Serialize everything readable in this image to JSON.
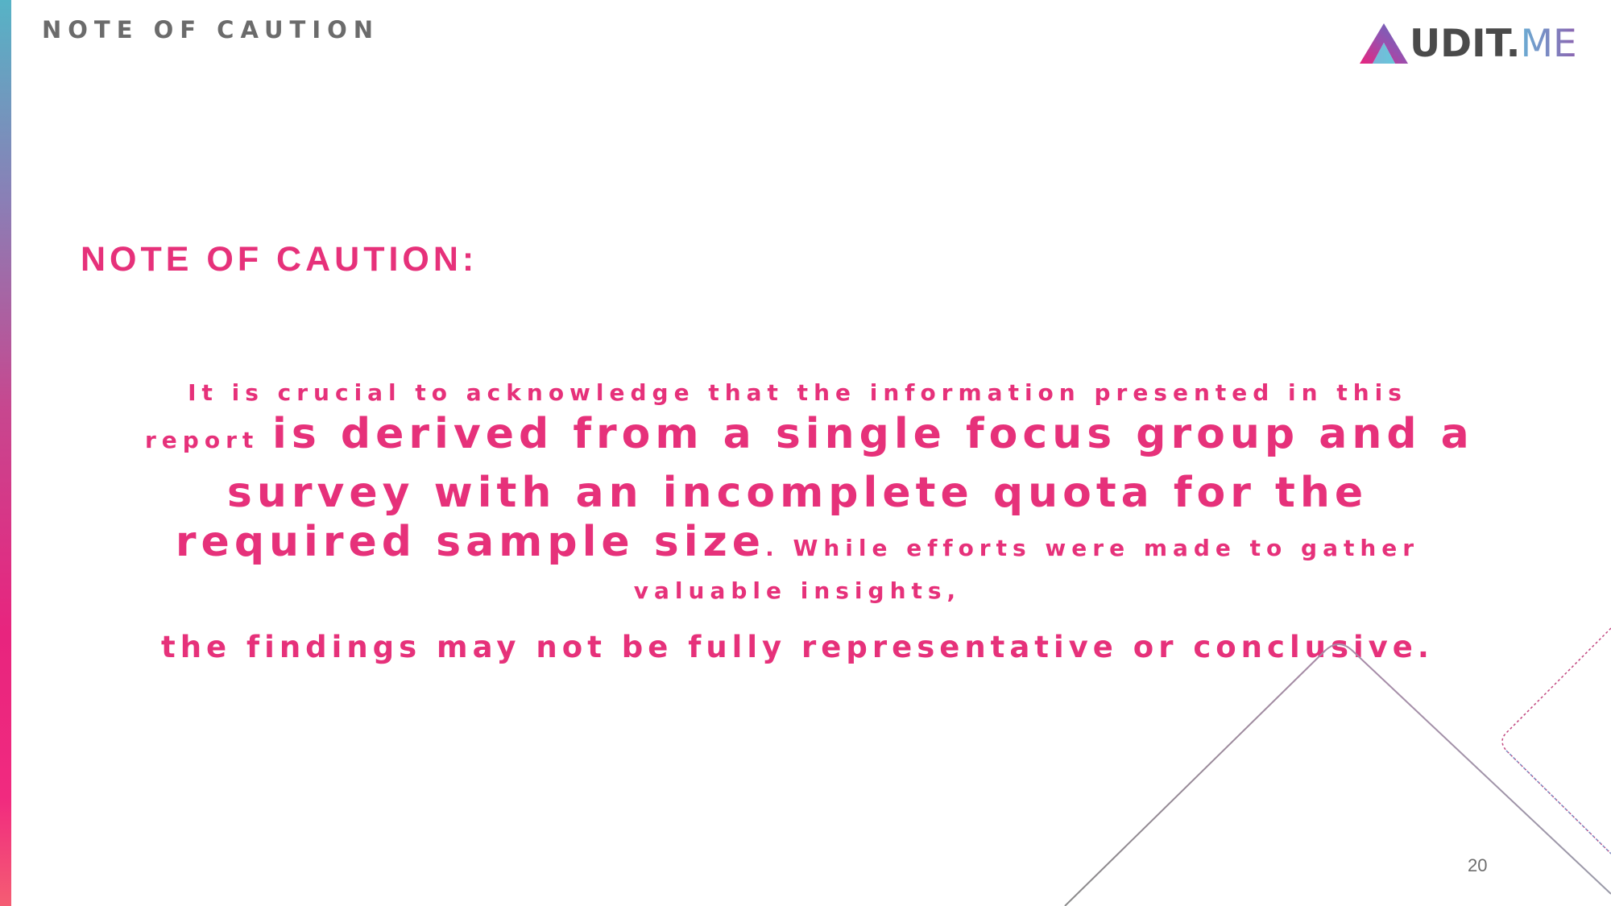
{
  "header": {
    "title": "NOTE OF CAUTION"
  },
  "logo": {
    "main": "UDIT.",
    "suffix": "ME"
  },
  "section": {
    "heading": "NOTE OF CAUTION:"
  },
  "body": {
    "line1": "It is crucial to acknowledge that the information presented in this",
    "line2_small": "report ",
    "line2_large": "is derived from a single focus group and a",
    "line3": "survey with an incomplete quota for the",
    "line4_large": "required sample size",
    "line4_small": ". While efforts were made to gather",
    "line5": "valuable insights,",
    "line6": "the findings may not be fully representative or conclusive."
  },
  "footer": {
    "page_number": "20"
  },
  "colors": {
    "accent": "#e6317a",
    "header_gray": "#6b6b6b"
  }
}
